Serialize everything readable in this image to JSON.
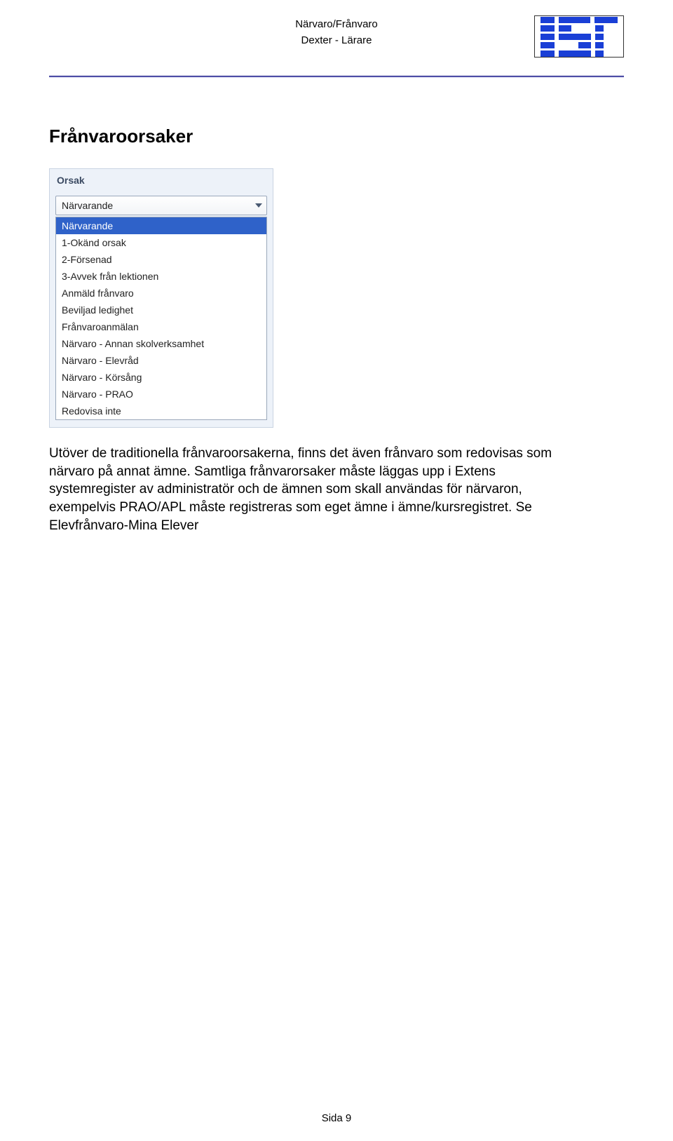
{
  "header": {
    "title1": "Närvaro/Frånvaro",
    "title2": "Dexter - Lärare",
    "logo_name": "IST"
  },
  "section_title": "Frånvaroorsaker",
  "orsak": {
    "label": "Orsak",
    "selected": "Närvarande",
    "options": [
      "Närvarande",
      "1-Okänd orsak",
      "2-Försenad",
      "3-Avvek från lektionen",
      "Anmäld frånvaro",
      "Beviljad ledighet",
      "Frånvaroanmälan",
      "Närvaro - Annan skolverksamhet",
      "Närvaro - Elevråd",
      "Närvaro - Körsång",
      "Närvaro - PRAO",
      "Redovisa inte"
    ]
  },
  "paragraph": "Utöver de traditionella frånvaroorsakerna, finns det även frånvaro som redovisas som närvaro på annat ämne. Samtliga frånvarorsaker måste läggas upp i Extens systemregister av administratör och de ämnen som skall användas för närvaron, exempelvis PRAO/APL måste registreras som eget ämne i ämne/kursregistret. Se Elevfrånvaro-Mina Elever",
  "footer": "Sida 9"
}
